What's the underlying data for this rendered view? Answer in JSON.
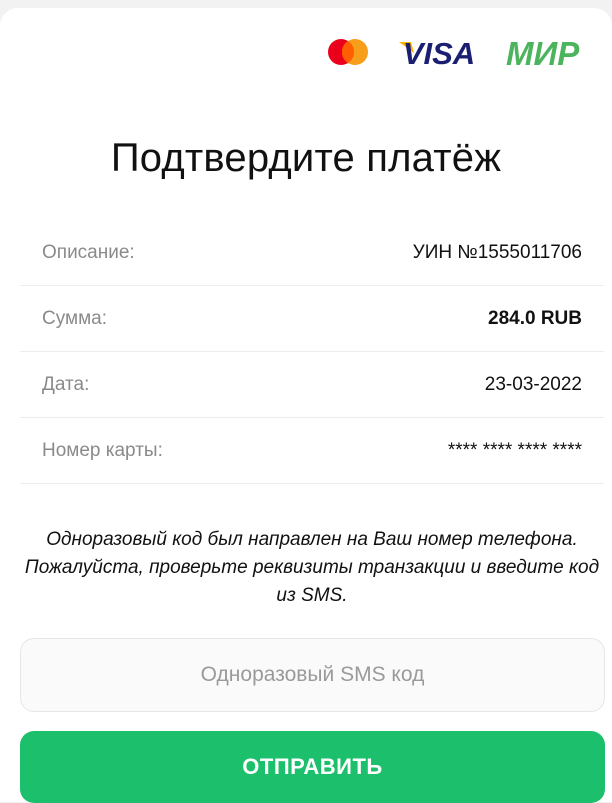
{
  "logos": {
    "mastercard": {
      "icon": "mastercard-logo",
      "colors": [
        "#eb001b",
        "#f79e1b",
        "#ff5f00"
      ]
    },
    "visa": {
      "text": "VISA",
      "icon": "visa-logo",
      "colors": [
        "#1a1f71",
        "#f7b600"
      ]
    },
    "mir": {
      "text": "МИР",
      "icon": "mir-logo",
      "colors": [
        "#4db45e",
        "#0f754e"
      ]
    }
  },
  "title": "Подтвердите платёж",
  "details": [
    {
      "label": "Описание:",
      "value": "УИН №1555011706"
    },
    {
      "label": "Сумма:",
      "value": "284.0 RUB"
    },
    {
      "label": "Дата:",
      "value": "23-03-2022"
    },
    {
      "label": "Номер карты:",
      "value": "**** **** **** ****"
    }
  ],
  "notice": "Одноразовый код был направлен на Ваш номер телефона. Пожалуйста, проверьте реквизиты транзакции и введите код из SMS.",
  "sms_input": {
    "value": "",
    "placeholder": "Одноразовый SMS код"
  },
  "submit_label": "ОТПРАВИТЬ",
  "colors": {
    "accent": "#1cbf6b",
    "label": "#8a8a8a",
    "text": "#111111"
  }
}
